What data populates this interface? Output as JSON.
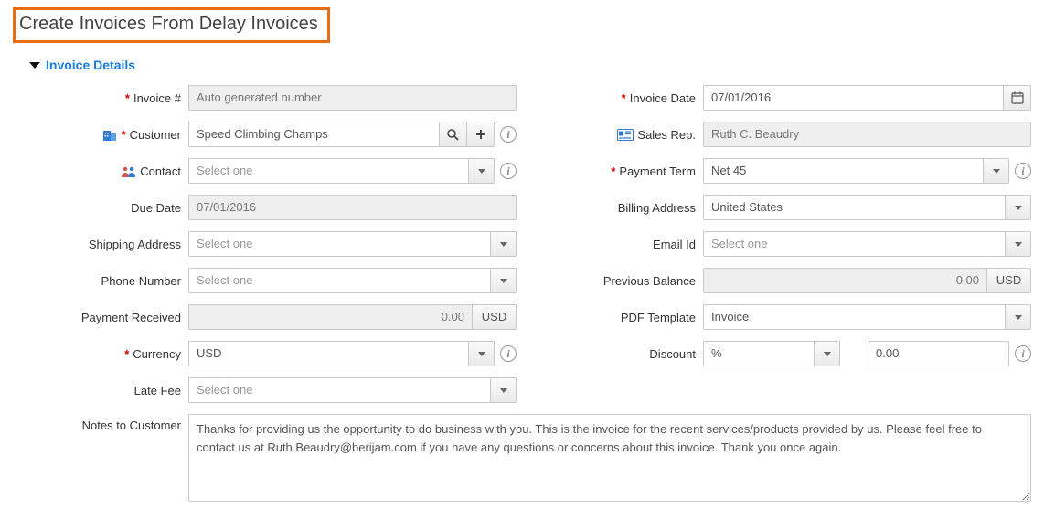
{
  "page": {
    "title": "Create Invoices From Delay Invoices"
  },
  "section": {
    "title": "Invoice Details"
  },
  "labels": {
    "invoice_no": "Invoice #",
    "customer": "Customer",
    "contact": "Contact",
    "due_date": "Due Date",
    "shipping_address": "Shipping Address",
    "phone_number": "Phone Number",
    "payment_received": "Payment Received",
    "currency": "Currency",
    "late_fee": "Late Fee",
    "notes": "Notes to Customer",
    "invoice_date": "Invoice Date",
    "sales_rep": "Sales Rep.",
    "payment_term": "Payment Term",
    "billing_address": "Billing Address",
    "email_id": "Email Id",
    "previous_balance": "Previous Balance",
    "pdf_template": "PDF Template",
    "discount": "Discount"
  },
  "placeholders": {
    "select_one": "Select one"
  },
  "values": {
    "invoice_no": "Auto generated number",
    "customer": "Speed Climbing Champs",
    "contact": "",
    "due_date": "07/01/2016",
    "shipping_address": "",
    "phone_number": "",
    "payment_received": "0.00",
    "payment_received_unit": "USD",
    "currency": "USD",
    "late_fee": "",
    "invoice_date": "07/01/2016",
    "sales_rep": "Ruth C. Beaudry",
    "payment_term": "Net 45",
    "billing_address": "United States",
    "email_id": "",
    "previous_balance": "0.00",
    "previous_balance_unit": "USD",
    "pdf_template": "Invoice",
    "discount_type": "%",
    "discount_value": "0.00",
    "notes": "Thanks for providing us the opportunity to do business with you. This is the invoice for the recent services/products provided by us. Please feel free to contact us at Ruth.Beaudry@berijam.com if you have any questions or concerns about this invoice. Thank you once again."
  }
}
